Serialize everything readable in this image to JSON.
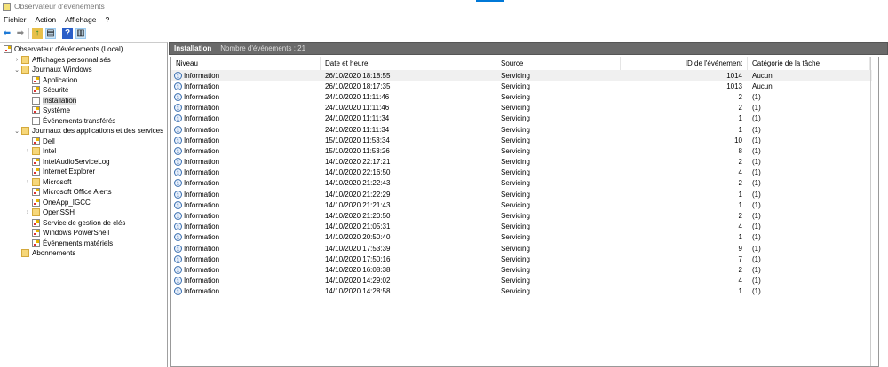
{
  "window": {
    "title": "Observateur d'événements"
  },
  "menu": [
    "Fichier",
    "Action",
    "Affichage",
    "?"
  ],
  "tree": [
    {
      "label": "Observateur d'événements (Local)",
      "level": 0,
      "chev": "",
      "icon": "log"
    },
    {
      "label": "Affichages personnalisés",
      "level": 1,
      "chev": ">",
      "icon": "folder"
    },
    {
      "label": "Journaux Windows",
      "level": 1,
      "chev": "v",
      "icon": "folder"
    },
    {
      "label": "Application",
      "level": 2,
      "chev": "",
      "icon": "log"
    },
    {
      "label": "Sécurité",
      "level": 2,
      "chev": "",
      "icon": "log"
    },
    {
      "label": "Installation",
      "level": 2,
      "chev": "",
      "icon": "plain",
      "selected": true
    },
    {
      "label": "Système",
      "level": 2,
      "chev": "",
      "icon": "log"
    },
    {
      "label": "Événements transférés",
      "level": 2,
      "chev": "",
      "icon": "plain"
    },
    {
      "label": "Journaux des applications et des services",
      "level": 1,
      "chev": "v",
      "icon": "folder"
    },
    {
      "label": "Dell",
      "level": 2,
      "chev": "",
      "icon": "log"
    },
    {
      "label": "Intel",
      "level": 2,
      "chev": ">",
      "icon": "folder"
    },
    {
      "label": "IntelAudioServiceLog",
      "level": 2,
      "chev": "",
      "icon": "log"
    },
    {
      "label": "Internet Explorer",
      "level": 2,
      "chev": "",
      "icon": "log"
    },
    {
      "label": "Microsoft",
      "level": 2,
      "chev": ">",
      "icon": "folder"
    },
    {
      "label": "Microsoft Office Alerts",
      "level": 2,
      "chev": "",
      "icon": "log"
    },
    {
      "label": "OneApp_IGCC",
      "level": 2,
      "chev": "",
      "icon": "log"
    },
    {
      "label": "OpenSSH",
      "level": 2,
      "chev": ">",
      "icon": "folder"
    },
    {
      "label": "Service de gestion de clés",
      "level": 2,
      "chev": "",
      "icon": "log"
    },
    {
      "label": "Windows PowerShell",
      "level": 2,
      "chev": "",
      "icon": "log"
    },
    {
      "label": "Événements matériels",
      "level": 2,
      "chev": "",
      "icon": "log"
    },
    {
      "label": "Abonnements",
      "level": 1,
      "chev": "",
      "icon": "folder"
    }
  ],
  "panel": {
    "title": "Installation",
    "count": "Nombre d'événements : 21"
  },
  "columns": [
    "Niveau",
    "Date et heure",
    "Source",
    "ID de l'événement",
    "Catégorie de la tâche"
  ],
  "rows": [
    [
      "Information",
      "26/10/2020 18:18:55",
      "Servicing",
      "1014",
      "Aucun"
    ],
    [
      "Information",
      "26/10/2020 18:17:35",
      "Servicing",
      "1013",
      "Aucun"
    ],
    [
      "Information",
      "24/10/2020 11:11:46",
      "Servicing",
      "2",
      "(1)"
    ],
    [
      "Information",
      "24/10/2020 11:11:46",
      "Servicing",
      "2",
      "(1)"
    ],
    [
      "Information",
      "24/10/2020 11:11:34",
      "Servicing",
      "1",
      "(1)"
    ],
    [
      "Information",
      "24/10/2020 11:11:34",
      "Servicing",
      "1",
      "(1)"
    ],
    [
      "Information",
      "15/10/2020 11:53:34",
      "Servicing",
      "10",
      "(1)"
    ],
    [
      "Information",
      "15/10/2020 11:53:26",
      "Servicing",
      "8",
      "(1)"
    ],
    [
      "Information",
      "14/10/2020 22:17:21",
      "Servicing",
      "2",
      "(1)"
    ],
    [
      "Information",
      "14/10/2020 22:16:50",
      "Servicing",
      "4",
      "(1)"
    ],
    [
      "Information",
      "14/10/2020 21:22:43",
      "Servicing",
      "2",
      "(1)"
    ],
    [
      "Information",
      "14/10/2020 21:22:29",
      "Servicing",
      "1",
      "(1)"
    ],
    [
      "Information",
      "14/10/2020 21:21:43",
      "Servicing",
      "1",
      "(1)"
    ],
    [
      "Information",
      "14/10/2020 21:20:50",
      "Servicing",
      "2",
      "(1)"
    ],
    [
      "Information",
      "14/10/2020 21:05:31",
      "Servicing",
      "4",
      "(1)"
    ],
    [
      "Information",
      "14/10/2020 20:50:40",
      "Servicing",
      "1",
      "(1)"
    ],
    [
      "Information",
      "14/10/2020 17:53:39",
      "Servicing",
      "9",
      "(1)"
    ],
    [
      "Information",
      "14/10/2020 17:50:16",
      "Servicing",
      "7",
      "(1)"
    ],
    [
      "Information",
      "14/10/2020 16:08:38",
      "Servicing",
      "2",
      "(1)"
    ],
    [
      "Information",
      "14/10/2020 14:29:02",
      "Servicing",
      "4",
      "(1)"
    ],
    [
      "Information",
      "14/10/2020 14:28:58",
      "Servicing",
      "1",
      "(1)"
    ]
  ]
}
